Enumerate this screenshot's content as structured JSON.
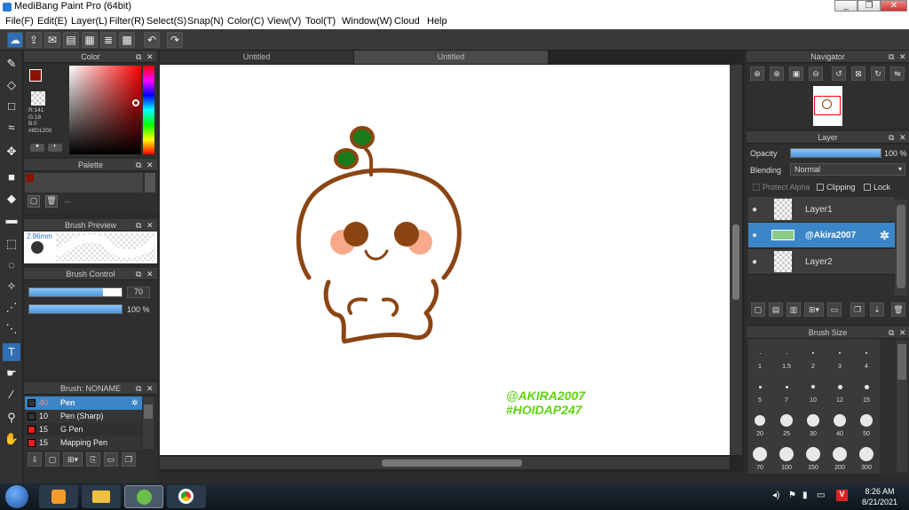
{
  "window": {
    "title": "MediBang Paint Pro (64bit)",
    "minimize": "_",
    "restore": "❐",
    "close": "✕"
  },
  "menu": [
    "File(F)",
    "Edit(E)",
    "Layer(L)",
    "Filter(R)",
    "Select(S)",
    "Snap(N)",
    "Color(C)",
    "View(V)",
    "Tool(T)",
    "Window(W)",
    "Cloud",
    "Help"
  ],
  "tabs": {
    "left": "Untitled",
    "right": "Untitled"
  },
  "color_panel": {
    "title": "Color",
    "r": "R:141",
    "g": "G:18",
    "b": "B:0",
    "hex": "#8D1200",
    "primary": "#8D1200",
    "secondary": "#ffffff"
  },
  "palette_panel": {
    "title": "Palette",
    "dash": "---"
  },
  "brush_preview": {
    "title": "Brush Preview",
    "size": "2.96mm"
  },
  "brush_control": {
    "title": "Brush Control",
    "size_value": "70",
    "opacity_value": "100 %",
    "size_fraction": 0.8,
    "opacity_fraction": 1.0
  },
  "brush_list": {
    "title": "Brush: NONAME",
    "items": [
      {
        "size": "40",
        "name": "Pen",
        "color": "#333333",
        "selected": true
      },
      {
        "size": "10",
        "name": "Pen (Sharp)",
        "color": "#333333",
        "selected": false
      },
      {
        "size": "15",
        "name": "G Pen",
        "color": "#e02020",
        "selected": false
      },
      {
        "size": "15",
        "name": "Mapping Pen",
        "color": "#e02020",
        "selected": false
      }
    ]
  },
  "navigator": {
    "title": "Navigator"
  },
  "layer_panel": {
    "title": "Layer",
    "opacity_label": "Opacity",
    "opacity_value": "100 %",
    "opacity_fraction": 1.0,
    "blending_label": "Blending",
    "blending_value": "Normal",
    "protect_alpha": "Protect Alpha",
    "clipping": "Clipping",
    "lock": "Lock",
    "layers": [
      {
        "name": "Layer1",
        "selected": false
      },
      {
        "name": "@Akira2007",
        "selected": true
      },
      {
        "name": "Layer2",
        "selected": false
      }
    ]
  },
  "brush_size": {
    "title": "Brush Size",
    "rows": [
      [
        "1",
        "1.5",
        "2",
        "3",
        "4"
      ],
      [
        "5",
        "7",
        "10",
        "12",
        "15"
      ],
      [
        "20",
        "25",
        "30",
        "40",
        "50"
      ],
      [
        "70",
        "100",
        "150",
        "200",
        "300"
      ]
    ]
  },
  "canvas_text": {
    "line1": "@AKIRA2007",
    "line2": "#HOIDAP247",
    "color": "#5fd40f"
  },
  "drawing_colors": {
    "outline": "#8B4513",
    "leaf": "#1a7a1a",
    "eye": "#8B4513",
    "blush": "#f7a98a"
  },
  "taskbar": {
    "time": "8:26 AM",
    "date": "8/21/2021"
  }
}
